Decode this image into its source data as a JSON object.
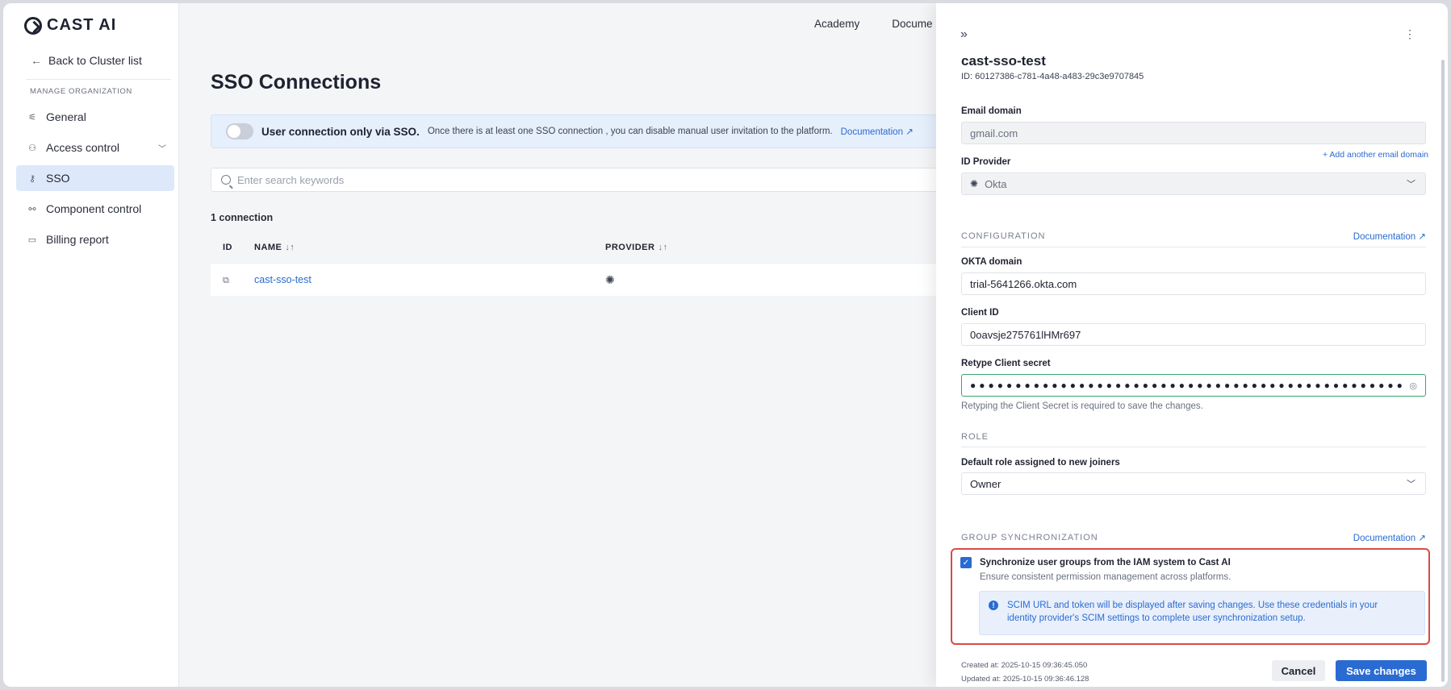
{
  "brand": {
    "name": "CAST AI"
  },
  "sidebar": {
    "back_label": "Back to Cluster list",
    "section_label": "MANAGE ORGANIZATION",
    "items": [
      {
        "label": "General",
        "icon": "sliders-icon"
      },
      {
        "label": "Access control",
        "icon": "users-icon"
      },
      {
        "label": "SSO",
        "icon": "key-icon"
      },
      {
        "label": "Component control",
        "icon": "nodes-icon"
      },
      {
        "label": "Billing report",
        "icon": "card-icon"
      }
    ]
  },
  "topnav": {
    "items": [
      "Academy",
      "Docume"
    ]
  },
  "main": {
    "title": "SSO Connections",
    "banner": {
      "strong": "User connection only via SSO.",
      "text": "Once there is at least one SSO connection , you can disable manual user invitation to the platform.",
      "link": "Documentation"
    },
    "search_placeholder": "Enter search keywords",
    "count": "1 connection",
    "table": {
      "headers": [
        "ID",
        "NAME",
        "PROVIDER"
      ],
      "rows": [
        {
          "name": "cast-sso-test"
        }
      ]
    }
  },
  "drawer": {
    "title": "cast-sso-test",
    "id": "ID: 60127386-c781-4a48-a483-29c3e9707845",
    "email_domain": {
      "label": "Email domain",
      "value": "gmail.com",
      "add_link": "+ Add another email domain"
    },
    "id_provider": {
      "label": "ID Provider",
      "value": "Okta"
    },
    "configuration": {
      "section": "CONFIGURATION",
      "doc_link": "Documentation",
      "okta_domain": {
        "label": "OKTA domain",
        "value": "trial-5641266.okta.com"
      },
      "client_id": {
        "label": "Client ID",
        "value": "0oavsje275761lHMr697"
      },
      "client_secret": {
        "label": "Retype Client secret",
        "value": "●●●●●●●●●●●●●●●●●●●●●●●●●●●●●●●●●●●●●●●●●●●●●●●●",
        "hint": "Retyping the Client Secret is required to save the changes."
      }
    },
    "role": {
      "section": "ROLE",
      "label": "Default role assigned to new joiners",
      "value": "Owner"
    },
    "group_sync": {
      "section": "GROUP SYNCHRONIZATION",
      "doc_link": "Documentation",
      "checkbox_label": "Synchronize user groups from the IAM system to Cast AI",
      "checked": true,
      "subtext": "Ensure consistent permission management across platforms.",
      "info_line1": "SCIM URL and token will be displayed after saving changes. Use these credentials in your",
      "info_line2": "identity provider's SCIM settings to complete user synchronization setup."
    },
    "created": "Created at: 2025-10-15 09:36:45.050",
    "updated": "Updated at: 2025-10-15 09:36:46.128",
    "cancel_label": "Cancel",
    "save_label": "Save changes"
  },
  "colors": {
    "accent": "#2a6bd1",
    "highlight": "#d84b48",
    "valid": "#3aa66a"
  }
}
